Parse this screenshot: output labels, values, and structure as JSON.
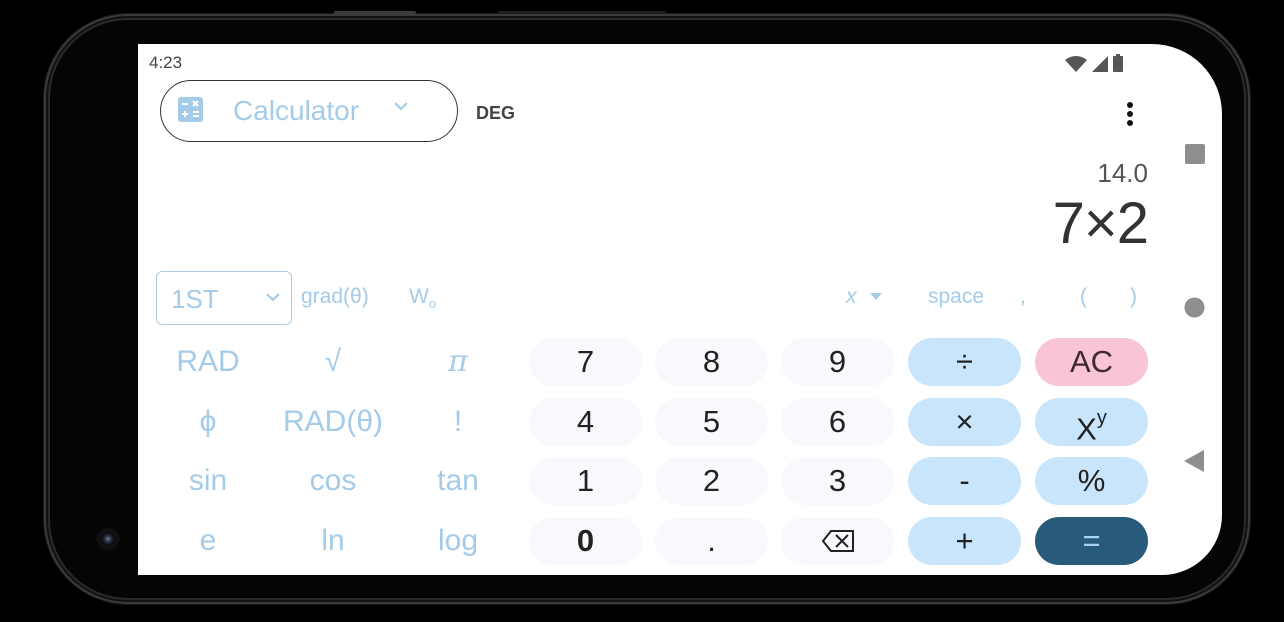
{
  "status_bar": {
    "time": "4:23",
    "icons": [
      "wifi-icon",
      "cellular-signal-icon",
      "battery-icon"
    ]
  },
  "toolbar": {
    "mode_selector": {
      "icon": "calculator-icon",
      "label": "Calculator",
      "chevron": "chevron-down-icon"
    },
    "angle_mode": "DEG",
    "overflow_icon": "more-vert-icon"
  },
  "display": {
    "result": "14.0",
    "expression": "7×2"
  },
  "aux_row": {
    "shift_dropdown": {
      "value": "1ST",
      "chevron": "chevron-down-icon"
    },
    "keys": [
      "grad(θ)",
      "W",
      "x",
      "space",
      ",",
      "(",
      ")"
    ],
    "w_subscript": "o"
  },
  "scientific_keys": [
    [
      "RAD",
      "√",
      "π"
    ],
    [
      "ϕ",
      "RAD(θ)",
      "!"
    ],
    [
      "sin",
      "cos",
      "tan"
    ],
    [
      "e",
      "ln",
      "log"
    ]
  ],
  "keypad": {
    "digits": [
      [
        "7",
        "8",
        "9"
      ],
      [
        "4",
        "5",
        "6"
      ],
      [
        "1",
        "2",
        "3"
      ],
      [
        "0",
        ".",
        "⌫"
      ]
    ],
    "operators": [
      "÷",
      "×",
      "-",
      "+"
    ],
    "right_column": {
      "clear": "AC",
      "power_base": "X",
      "power_exp": "y",
      "percent": "%",
      "equals": "="
    }
  },
  "nav_bar": {
    "buttons": [
      "recents-square-icon",
      "home-circle-icon",
      "back-triangle-icon"
    ]
  },
  "colors": {
    "accent_light": "#a4cbe8",
    "operator_bg": "#c9e5fb",
    "digit_bg": "#f7f9fc",
    "clear_bg": "#f9c3d8",
    "equals_bg": "#285a7c",
    "equals_fg": "#a8d2f0"
  }
}
